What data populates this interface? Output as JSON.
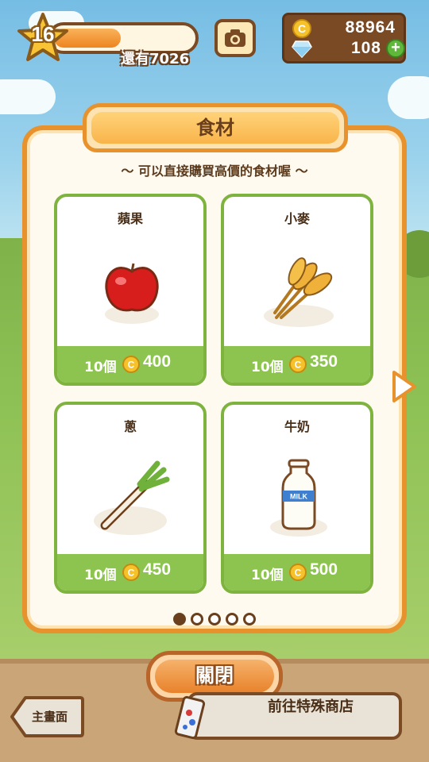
{
  "hud": {
    "level": "16",
    "level_progress": 0.48,
    "exp_text": "還有7026",
    "coins": "88964",
    "gems": "108",
    "gems_add_label": "+"
  },
  "panel": {
    "title": "食材",
    "subtitle": "～ 可以直接購買高價的食材喔 ～"
  },
  "items": [
    {
      "name": "蘋果",
      "qty": "10個",
      "price": "400",
      "icon": "apple-icon"
    },
    {
      "name": "小麥",
      "qty": "10個",
      "price": "350",
      "icon": "wheat-icon"
    },
    {
      "name": "蔥",
      "qty": "10個",
      "price": "450",
      "icon": "leek-icon"
    },
    {
      "name": "牛奶",
      "qty": "10個",
      "price": "500",
      "icon": "milk-icon"
    }
  ],
  "milk_label": "MILK",
  "pagination": {
    "total": 5,
    "current": 1
  },
  "buttons": {
    "close": "關閉",
    "home": "主畫面",
    "special_shop": "前往特殊商店"
  },
  "colors": {
    "panel_border": "#e8922d",
    "card_border": "#7fb340",
    "price_bar": "#8dc34f",
    "brown": "#7a4a24"
  }
}
